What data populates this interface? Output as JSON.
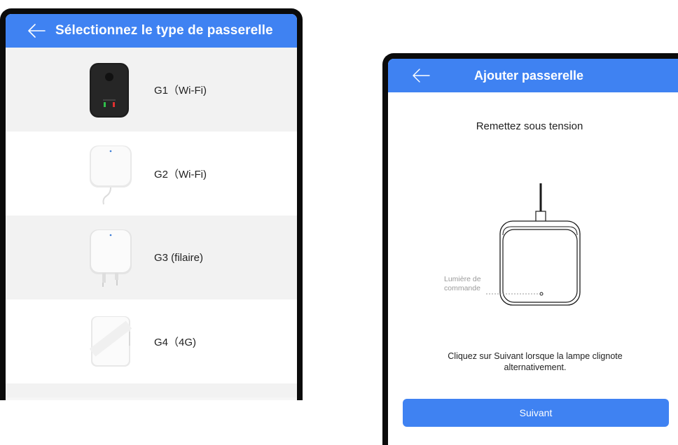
{
  "left_screen": {
    "header_title": "Sélectionnez le type de passerelle",
    "back_icon": "arrow-left-icon",
    "gateways": [
      {
        "label": "G1（Wi-Fi)"
      },
      {
        "label": "G2（Wi-Fi)"
      },
      {
        "label": "G3 (filaire)"
      },
      {
        "label": "G4（4G)"
      }
    ]
  },
  "right_screen": {
    "header_title": "Ajouter passerelle",
    "back_icon": "arrow-left-icon",
    "heading": "Remettez sous tension",
    "indicator_label_line1": "Lumière de",
    "indicator_label_line2": "commande",
    "instruction": "Cliquez sur Suivant lorsque la lampe clignote alternativement.",
    "next_button": "Suivant"
  },
  "colors": {
    "accent": "#3f82f2",
    "row_grey": "#f2f2f2",
    "bezel": "#0b0b0b"
  }
}
